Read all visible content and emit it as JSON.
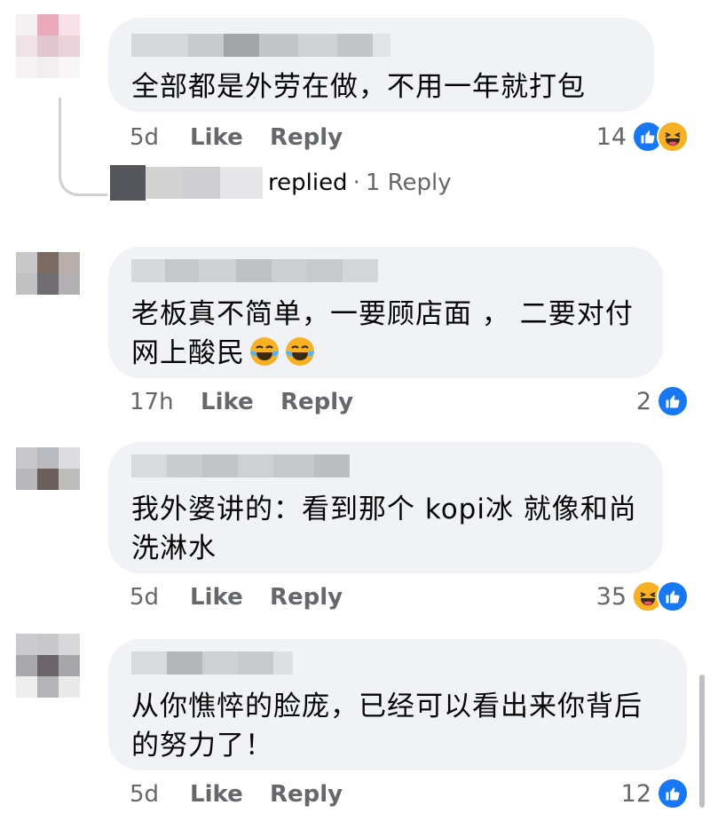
{
  "comments": [
    {
      "text": "全部都是外劳在做，不用一年就打包",
      "time": "5d",
      "like_label": "Like",
      "reply_label": "Reply",
      "reaction_count": "14",
      "reactions": [
        "like-icon",
        "haha-icon"
      ],
      "replies": {
        "replied_label": "replied",
        "separator": "·",
        "reply_count_label": "1 Reply"
      }
    },
    {
      "text": "老板真不简单，一要顾店面 ， 二要对付网上酸民",
      "emojis": [
        "tears-of-joy-emoji",
        "tears-of-joy-emoji"
      ],
      "time": "17h",
      "like_label": "Like",
      "reply_label": "Reply",
      "reaction_count": "2",
      "reactions": [
        "like-icon"
      ]
    },
    {
      "text": "我外婆讲的：看到那个 kopi冰 就像和尚洗淋水",
      "time": "5d",
      "like_label": "Like",
      "reply_label": "Reply",
      "reaction_count": "35",
      "reactions": [
        "haha-icon",
        "like-icon"
      ]
    },
    {
      "text": "从你憔悴的脸庞，已经可以看出来你背后的努力了！",
      "time": "5d",
      "like_label": "Like",
      "reply_label": "Reply",
      "reaction_count": "12",
      "reactions": [
        "like-icon"
      ]
    }
  ],
  "colors": {
    "bubble": "#f0f2f5",
    "meta_text": "#65676b",
    "like_blue": "#1877f2",
    "haha_yellow": "#f7b125"
  }
}
